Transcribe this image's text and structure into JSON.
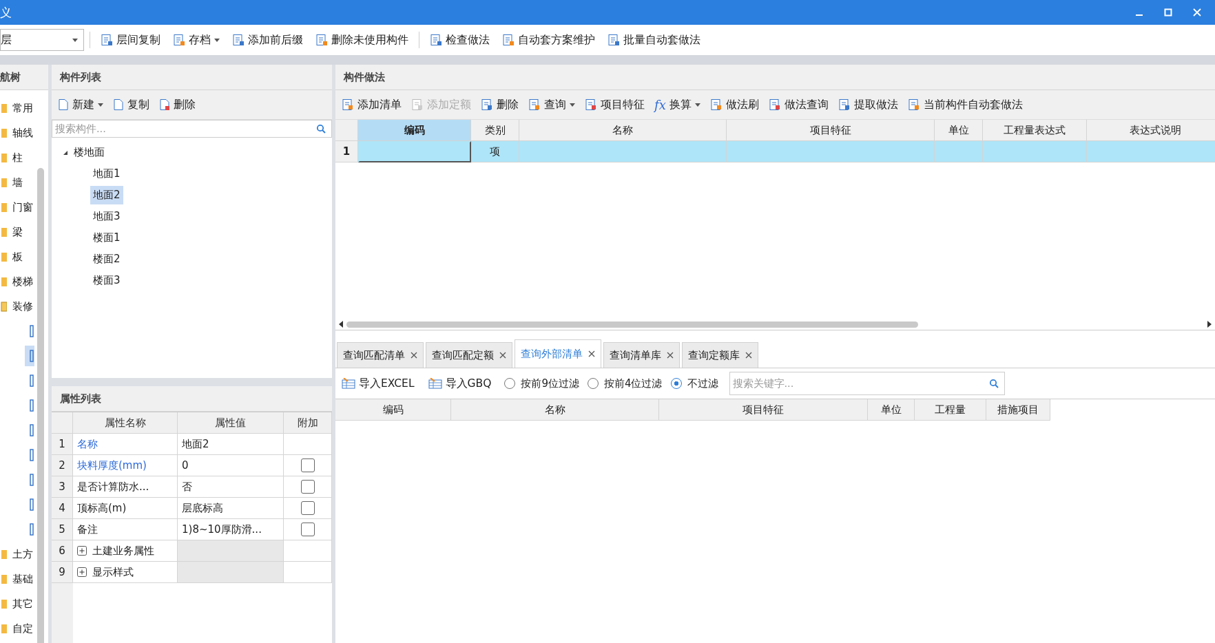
{
  "window": {
    "title": "义"
  },
  "toolbar": {
    "floor_select": {
      "value": "层"
    },
    "items": [
      {
        "label": "层间复制",
        "dropdown": false
      },
      {
        "label": "存档",
        "dropdown": true
      },
      {
        "label": "添加前后缀",
        "dropdown": false
      },
      {
        "label": "删除未使用构件",
        "dropdown": false
      },
      {
        "label": "检查做法",
        "dropdown": false
      },
      {
        "label": "自动套方案维护",
        "dropdown": false
      },
      {
        "label": "批量自动套做法",
        "dropdown": false
      }
    ]
  },
  "nav": {
    "title": "航树",
    "items": [
      {
        "label": "常用",
        "expanded": false
      },
      {
        "label": "轴线",
        "expanded": false
      },
      {
        "label": "柱",
        "expanded": false
      },
      {
        "label": "墙",
        "expanded": false
      },
      {
        "label": "门窗",
        "expanded": false
      },
      {
        "label": "梁",
        "expanded": false
      },
      {
        "label": "板",
        "expanded": false
      },
      {
        "label": "楼梯",
        "expanded": false
      },
      {
        "label": "装修",
        "expanded": true,
        "children": [
          {
            "selected": false
          },
          {
            "selected": true
          },
          {
            "selected": false
          },
          {
            "selected": false
          },
          {
            "selected": false
          },
          {
            "selected": false
          },
          {
            "selected": false
          },
          {
            "selected": false
          },
          {
            "selected": false
          }
        ]
      },
      {
        "label": "土方",
        "expanded": false
      },
      {
        "label": "基础",
        "expanded": false
      },
      {
        "label": "其它",
        "expanded": false
      },
      {
        "label": "自定",
        "expanded": false
      }
    ]
  },
  "component_list": {
    "title": "构件列表",
    "toolbar": [
      {
        "label": "新建",
        "dropdown": true
      },
      {
        "label": "复制",
        "dropdown": false
      },
      {
        "label": "删除",
        "dropdown": false
      }
    ],
    "search": {
      "placeholder": "搜索构件..."
    },
    "tree": [
      {
        "label": "楼地面",
        "expanded": true,
        "selected": false,
        "children": [
          {
            "label": "地面1",
            "selected": false
          },
          {
            "label": "地面2",
            "selected": true
          },
          {
            "label": "地面3",
            "selected": false
          },
          {
            "label": "楼面1",
            "selected": false
          },
          {
            "label": "楼面2",
            "selected": false
          },
          {
            "label": "楼面3",
            "selected": false
          }
        ]
      }
    ]
  },
  "properties": {
    "title": "属性列表",
    "columns": [
      "属性名称",
      "属性值",
      "附加"
    ],
    "rows": [
      {
        "number": "1",
        "kind": "field",
        "name": "名称",
        "public": true,
        "value": "地面2"
      },
      {
        "number": "2",
        "kind": "field",
        "name": "块料厚度(mm)",
        "public": true,
        "value": "0",
        "checked": false
      },
      {
        "number": "3",
        "kind": "field",
        "name": "是否计算防水...",
        "public": false,
        "value": "否",
        "checked": false
      },
      {
        "number": "4",
        "kind": "field",
        "name": "顶标高(m)",
        "public": false,
        "value": "层底标高",
        "checked": false
      },
      {
        "number": "5",
        "kind": "field",
        "name": "备注",
        "public": false,
        "value": "1)8~10厚防滑...",
        "checked": false
      },
      {
        "number": "6",
        "kind": "group",
        "name": "土建业务属性",
        "expanded": false
      },
      {
        "number": "9",
        "kind": "group",
        "name": "显示样式",
        "expanded": false
      }
    ]
  },
  "method": {
    "title": "构件做法",
    "toolbar": [
      {
        "label": "添加清单",
        "dropdown": false,
        "disabled": false
      },
      {
        "label": "添加定额",
        "dropdown": false,
        "disabled": true
      },
      {
        "label": "删除",
        "dropdown": false,
        "disabled": false
      },
      {
        "label": "查询",
        "dropdown": true,
        "disabled": false
      },
      {
        "label": "项目特征",
        "dropdown": false,
        "disabled": false
      },
      {
        "label": "换算",
        "dropdown": true,
        "disabled": false,
        "kind": "fx"
      },
      {
        "label": "做法刷",
        "dropdown": false,
        "disabled": false
      },
      {
        "label": "做法查询",
        "dropdown": false,
        "disabled": false
      },
      {
        "label": "提取做法",
        "dropdown": false,
        "disabled": false
      },
      {
        "label": "当前构件自动套做法",
        "dropdown": false,
        "disabled": false
      }
    ],
    "columns": [
      {
        "label": "编码",
        "selected": true
      },
      {
        "label": "类别",
        "selected": false
      },
      {
        "label": "名称",
        "selected": false
      },
      {
        "label": "项目特征",
        "selected": false
      },
      {
        "label": "单位",
        "selected": false
      },
      {
        "label": "工程量表达式",
        "selected": false
      },
      {
        "label": "表达式说明",
        "selected": false
      }
    ],
    "rows": [
      {
        "number": "1",
        "category": "项",
        "selected": true
      }
    ]
  },
  "query": {
    "tabs": [
      {
        "label": "查询匹配清单",
        "selected": false
      },
      {
        "label": "查询匹配定额",
        "selected": false
      },
      {
        "label": "查询外部清单",
        "selected": true
      },
      {
        "label": "查询清单库",
        "selected": false
      },
      {
        "label": "查询定额库",
        "selected": false
      }
    ],
    "buttons": [
      "导入EXCEL",
      "导入GBQ"
    ],
    "filters": [
      {
        "label": "按前9位过滤",
        "selected": false
      },
      {
        "label": "按前4位过滤",
        "selected": false
      },
      {
        "label": "不过滤",
        "selected": true
      }
    ],
    "search": {
      "placeholder": "搜索关键字..."
    },
    "columns": [
      "编码",
      "名称",
      "项目特征",
      "单位",
      "工程量",
      "措施项目"
    ]
  }
}
